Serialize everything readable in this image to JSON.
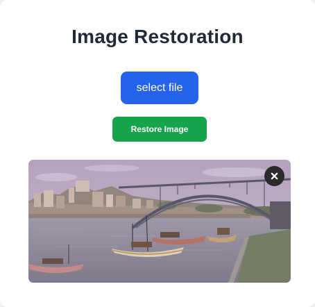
{
  "page": {
    "title": "Image Restoration"
  },
  "controls": {
    "select_file_label": "select file",
    "restore_label": "Restore Image"
  },
  "preview": {
    "close_icon": "close-icon",
    "subject": "riverside town with arched iron bridge and moored boats"
  },
  "colors": {
    "title": "#1f2937",
    "select_button": "#2563eb",
    "restore_button": "#16a34a",
    "close_button": "#2b2b2b"
  }
}
